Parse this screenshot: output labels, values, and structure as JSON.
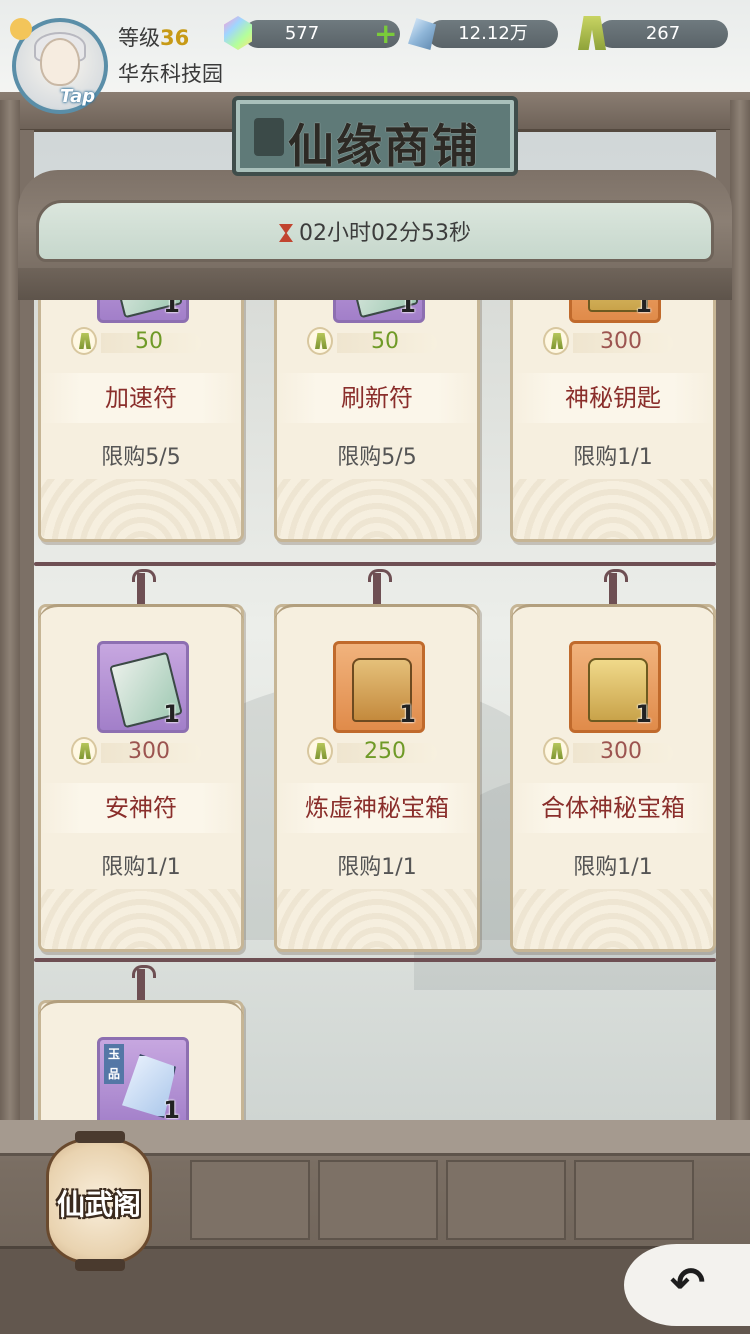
{
  "header": {
    "level_label": "等级",
    "level_value": "36",
    "location": "华东科技园",
    "avatar_badge": "Tap",
    "resources": [
      {
        "icon": "rainbow-gem-icon",
        "value": "577"
      },
      {
        "icon": "crystal-icon",
        "value": "12.12万"
      },
      {
        "icon": "jade-token-icon",
        "value": "267"
      }
    ]
  },
  "shop": {
    "title": "仙缘商铺",
    "timer": "02小时02分53秒"
  },
  "items": [
    {
      "name": "加速符",
      "count": "1",
      "price": "50",
      "price_color": "green",
      "limit": "限购5/5",
      "rarity": "purple"
    },
    {
      "name": "刷新符",
      "count": "1",
      "price": "50",
      "price_color": "green",
      "limit": "限购5/5",
      "rarity": "purple"
    },
    {
      "name": "神秘钥匙",
      "count": "1",
      "price": "300",
      "price_color": "red",
      "limit": "限购1/1",
      "rarity": "orange"
    },
    {
      "name": "安神符",
      "count": "1",
      "price": "300",
      "price_color": "red",
      "limit": "限购1/1",
      "rarity": "purple"
    },
    {
      "name": "炼虚神秘宝箱",
      "count": "1",
      "price": "250",
      "price_color": "green",
      "limit": "限购1/1",
      "rarity": "orange"
    },
    {
      "name": "合体神秘宝箱",
      "count": "1",
      "price": "300",
      "price_color": "red",
      "limit": "限购1/1",
      "rarity": "orange"
    },
    {
      "name": "",
      "count": "1",
      "price": "",
      "limit": "",
      "rarity": "purple",
      "grade": "玉品"
    }
  ],
  "footer": {
    "lantern_label": "仙武阁",
    "back_icon": "back-arrow-icon"
  },
  "colors": {
    "price_green": "#6f9a27",
    "price_red": "#9c5450",
    "item_name": "#8a2e2b",
    "frame": "#6e6258"
  }
}
